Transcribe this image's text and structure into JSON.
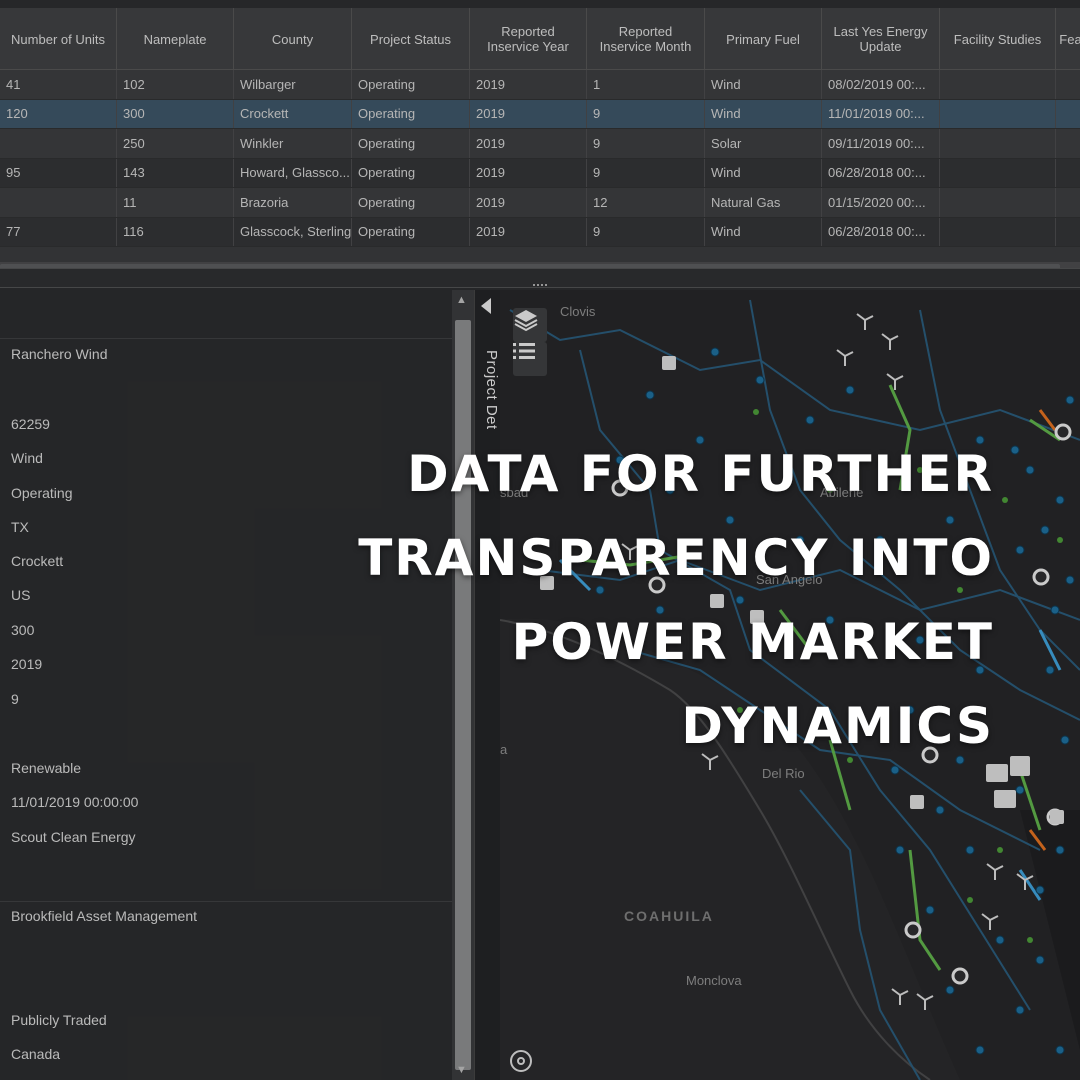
{
  "table": {
    "columns": [
      "Number of Units",
      "Nameplate",
      "County",
      "Project Status",
      "Reported Inservice Year",
      "Reported Inservice Month",
      "Primary Fuel",
      "Last Yes Energy Update",
      "Facility Studies",
      "Fea"
    ],
    "rows": [
      [
        "41",
        "102",
        "Wilbarger",
        "Operating",
        "2019",
        "1",
        "Wind",
        "08/02/2019 00:...",
        "",
        ""
      ],
      [
        "120",
        "300",
        "Crockett",
        "Operating",
        "2019",
        "9",
        "Wind",
        "11/01/2019 00:...",
        "",
        ""
      ],
      [
        "",
        "250",
        "Winkler",
        "Operating",
        "2019",
        "9",
        "Solar",
        "09/11/2019 00:...",
        "",
        ""
      ],
      [
        "95",
        "143",
        "Howard, Glassco...",
        "Operating",
        "2019",
        "9",
        "Wind",
        "06/28/2018 00:...",
        "",
        ""
      ],
      [
        "",
        "11",
        "Brazoria",
        "Operating",
        "2019",
        "12",
        "Natural Gas",
        "01/15/2020 00:...",
        "",
        ""
      ],
      [
        "77",
        "116",
        "Glasscock, Sterling",
        "Operating",
        "2019",
        "9",
        "Wind",
        "06/28/2018 00:...",
        "",
        ""
      ]
    ],
    "selected_row": 1
  },
  "details": {
    "name": "Ranchero Wind",
    "id": "62259",
    "fuel": "Wind",
    "status": "Operating",
    "state": "TX",
    "county": "Crockett",
    "country": "US",
    "nameplate": "300",
    "year": "2019",
    "month": "9",
    "category": "Renewable",
    "update": "11/01/2019 00:00:00",
    "developer": "Scout Clean Energy",
    "owner": "Brookfield Asset Management",
    "ownership_type": "Publicly Traded",
    "owner_country": "Canada"
  },
  "side_tab": {
    "label": "Project Det"
  },
  "map": {
    "labels": {
      "clovis": "Clovis",
      "carlsbad": "sbad",
      "abilene": "Abilene",
      "san_angelo": "San Angelo",
      "del_rio": "Del Rio",
      "coahuila": "COAHUILA",
      "monclova": "Monclova",
      "a": "a"
    },
    "icons": {
      "layers": "layers-icon",
      "list": "list-icon",
      "locate": "locate-icon"
    },
    "colors": {
      "wind_line": "#5fb04a",
      "transmission": "#2a5b7a",
      "node": "#1f6e9a",
      "accent": "#e07020"
    }
  },
  "overlay": {
    "headline_lines": [
      "DATA FOR FURTHER",
      "TRANSPARENCY INTO",
      "POWER MARKET",
      "DYNAMICS"
    ]
  }
}
